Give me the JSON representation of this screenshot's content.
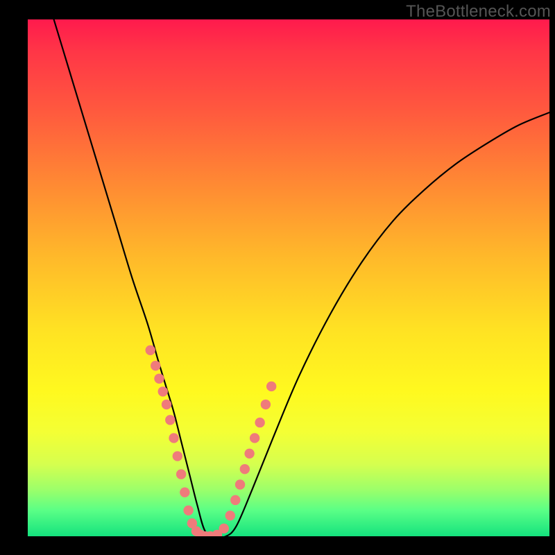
{
  "watermark": {
    "text": "TheBottleneck.com"
  },
  "chart_data": {
    "type": "line",
    "title": "",
    "xlabel": "",
    "ylabel": "",
    "xlim": [
      0,
      100
    ],
    "ylim": [
      0,
      100
    ],
    "grid": false,
    "legend": false,
    "background_gradient": {
      "top": "#ff1a4d",
      "bottom": "#14e27e",
      "stops": [
        "red",
        "orange",
        "yellow",
        "green"
      ]
    },
    "series": [
      {
        "name": "curve",
        "color": "#000000",
        "x": [
          5,
          8,
          11,
          14,
          17,
          20,
          23,
          25,
          26.5,
          28,
          29.5,
          31,
          32.5,
          34,
          36,
          38,
          40,
          43,
          47,
          52,
          58,
          64,
          70,
          76,
          82,
          88,
          94,
          100
        ],
        "y": [
          100,
          90,
          80,
          70,
          60,
          50,
          41,
          34,
          29,
          24,
          18,
          12,
          6,
          1,
          0,
          0,
          2,
          9,
          19,
          31,
          43,
          53,
          61,
          67,
          72,
          76,
          79.5,
          82
        ]
      },
      {
        "name": "dots",
        "color": "#ef7b7b",
        "marker": "circle",
        "x": [
          23.5,
          24.5,
          25.2,
          25.9,
          26.6,
          27.3,
          28.0,
          28.7,
          29.4,
          30.1,
          30.8,
          31.5,
          32.3,
          33.1,
          34.0,
          35.0,
          36.3,
          37.6,
          38.8,
          39.8,
          40.7,
          41.6,
          42.5,
          43.5,
          44.5,
          45.6,
          46.7
        ],
        "y": [
          36,
          33,
          30.5,
          28,
          25.5,
          22.5,
          19,
          15.5,
          12,
          8.5,
          5,
          2.5,
          1,
          0.3,
          0,
          0,
          0.3,
          1.5,
          4,
          7,
          10,
          13,
          16,
          19,
          22,
          25.5,
          29
        ]
      }
    ]
  }
}
